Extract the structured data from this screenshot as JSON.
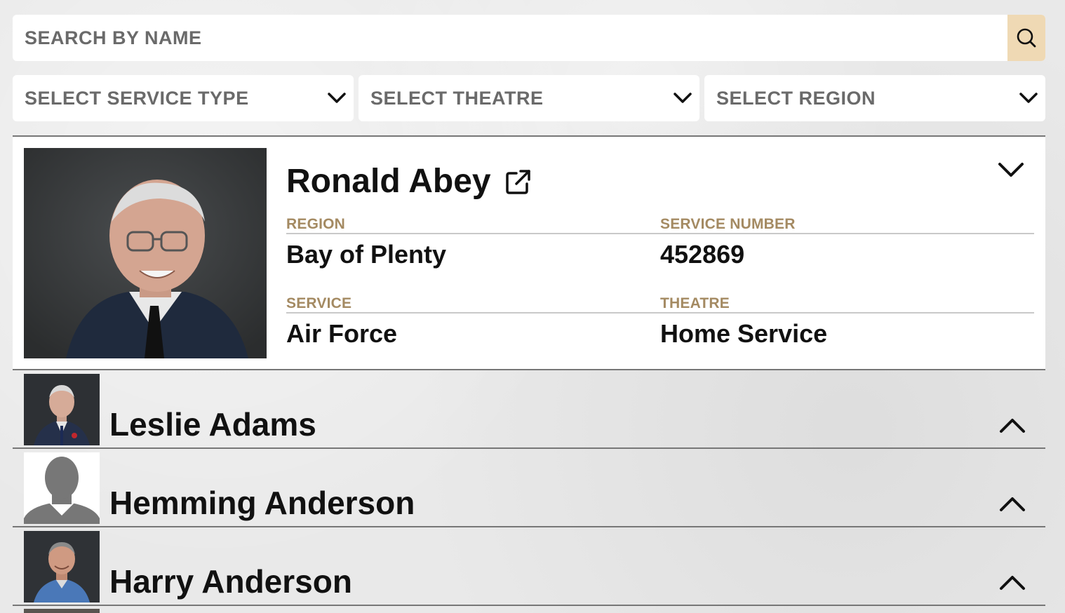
{
  "search": {
    "placeholder": "SEARCH BY NAME",
    "value": ""
  },
  "filters": {
    "service_type": "SELECT SERVICE TYPE",
    "theatre": "SELECT THEATRE",
    "region": "SELECT REGION"
  },
  "expanded": {
    "name": "Ronald Abey",
    "region_label": "REGION",
    "region": "Bay of Plenty",
    "service_number_label": "SERVICE NUMBER",
    "service_number": "452869",
    "service_label": "SERVICE",
    "service": "Air Force",
    "theatre_label": "THEATRE",
    "theatre": "Home Service"
  },
  "rows": [
    {
      "name": "Leslie Adams"
    },
    {
      "name": "Hemming Anderson"
    },
    {
      "name": "Harry Anderson"
    }
  ],
  "colors": {
    "accent_search": "#efd9b4",
    "label_gold": "#a48a62"
  }
}
